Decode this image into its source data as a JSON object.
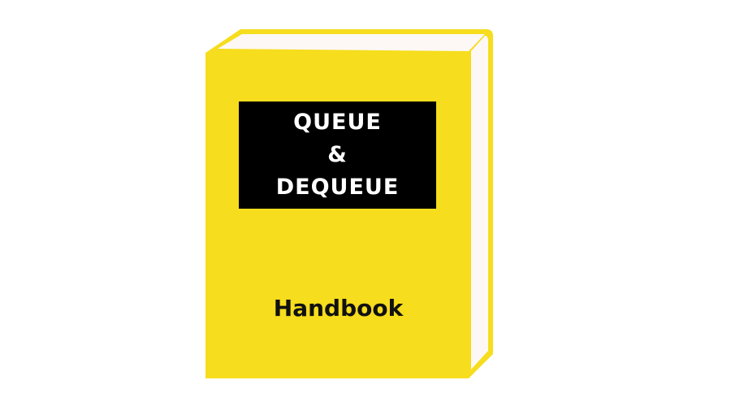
{
  "book": {
    "cover_color": "#f6dd1d",
    "pages_color": "#fdf8f5",
    "title_lines": [
      "QUEUE",
      "&",
      "DEQUEUE"
    ],
    "subtitle": "Handbook"
  }
}
